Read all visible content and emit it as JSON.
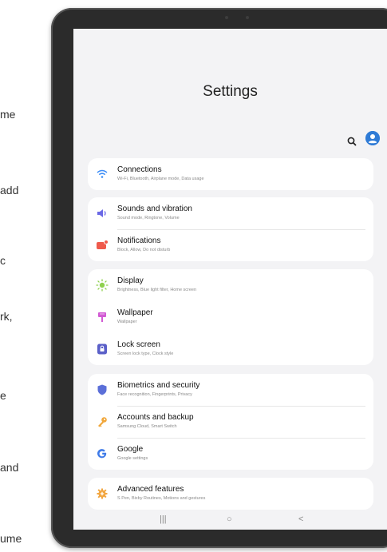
{
  "edge_text": [
    "me",
    "add",
    "c",
    "rk,",
    "e",
    "and",
    "ume"
  ],
  "screen": {
    "title": "Settings"
  },
  "groups": [
    {
      "items": [
        {
          "label": "Connections",
          "sub": "Wi-Fi, Bluetooth, Airplane mode, Data usage",
          "icon": "wifi-icon",
          "color": "#3e8ef7"
        }
      ]
    },
    {
      "items": [
        {
          "label": "Sounds and vibration",
          "sub": "Sound mode, Ringtone, Volume",
          "icon": "volume-icon",
          "color": "#6a68e6"
        },
        {
          "label": "Notifications",
          "sub": "Block, Allow, Do not disturb",
          "icon": "notification-icon",
          "color": "#ef5a4c"
        }
      ]
    },
    {
      "items": [
        {
          "label": "Display",
          "sub": "Brightness, Blue light filter, Home screen",
          "icon": "display-icon",
          "color": "#8fd14f"
        },
        {
          "label": "Wallpaper",
          "sub": "Wallpaper",
          "icon": "wallpaper-icon",
          "color": "#d25bd4"
        },
        {
          "label": "Lock screen",
          "sub": "Screen lock type, Clock style",
          "icon": "lock-icon",
          "color": "#5a5fc8"
        }
      ]
    },
    {
      "items": [
        {
          "label": "Biometrics and security",
          "sub": "Face recognition, Fingerprints, Privacy",
          "icon": "shield-icon",
          "color": "#5b6fd8"
        },
        {
          "label": "Accounts and backup",
          "sub": "Samsung Cloud, Smart Switch",
          "icon": "key-icon",
          "color": "#f1a73b"
        },
        {
          "label": "Google",
          "sub": "Google settings",
          "icon": "google-icon",
          "color": "#3f7be8"
        }
      ]
    },
    {
      "items": [
        {
          "label": "Advanced features",
          "sub": "S Pen, Bixby Routines, Motions and gestures",
          "icon": "gear-plus-icon",
          "color": "#f2a640"
        }
      ]
    }
  ],
  "nav": {
    "recents": "|||",
    "home": "○",
    "back": "<"
  }
}
